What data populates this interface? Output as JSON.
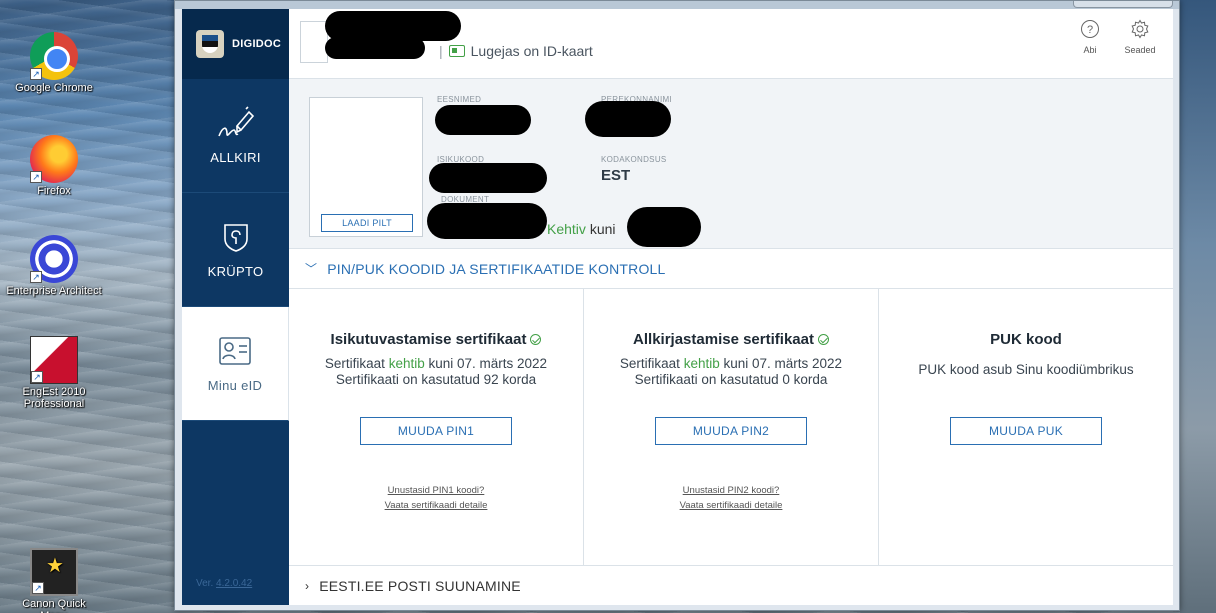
{
  "desktop": {
    "icons": [
      {
        "label": "Google Chrome",
        "icon": "chrome-icon"
      },
      {
        "label": "Firefox",
        "icon": "firefox-icon"
      },
      {
        "label": "Enterprise Architect",
        "icon": "enterprise-architect-icon"
      },
      {
        "label": "EngEst 2010 Professional",
        "icon": "engest-icon"
      },
      {
        "label": "Canon Quick Menu",
        "icon": "canon-quick-menu-icon"
      }
    ]
  },
  "app": {
    "brand": "DIGIDOC",
    "nav": [
      {
        "label": "ALLKIRI",
        "icon": "signature-icon"
      },
      {
        "label": "KRÜPTO",
        "icon": "shield-lock-icon"
      },
      {
        "label": "Minu eID",
        "icon": "id-card-icon",
        "active": true
      }
    ],
    "version_prefix": "Ver.",
    "version": "4.2.0.42"
  },
  "header": {
    "reader_status": "Lugejas on ID-kaart",
    "help_label": "Abi",
    "settings_label": "Seaded"
  },
  "person": {
    "given_names_label": "EESNIMED",
    "surname_label": "PEREKONNANIMI",
    "personal_code_label": "ISIKUKOOD",
    "citizenship_label": "KODAKONDSUS",
    "citizenship_value": "EST",
    "document_label": "DOKUMENT",
    "validity_status": "Kehtiv",
    "validity_until": "kuni",
    "load_photo_label": "LAADI PILT"
  },
  "sections": {
    "pin_puk_title": "PIN/PUK KOODID JA SERTIFIKAATIDE KONTROLL",
    "email_forward_title": "EESTI.EE POSTI SUUNAMINE"
  },
  "certs": {
    "auth": {
      "title": "Isikutuvastamise sertifikaat",
      "line1_prefix": "Sertifikaat",
      "line1_status": "kehtib",
      "line1_suffix": "kuni 07. märts 2022",
      "line2": "Sertifikaati on kasutatud 92 korda",
      "button": "MUUDA PIN1",
      "link_forgot": "Unustasid PIN1 koodi?",
      "link_details": "Vaata sertifikaadi detaile"
    },
    "sign": {
      "title": "Allkirjastamise sertifikaat",
      "line1_prefix": "Sertifikaat",
      "line1_status": "kehtib",
      "line1_suffix": "kuni 07. märts 2022",
      "line2": "Sertifikaati on kasutatud 0 korda",
      "button": "MUUDA PIN2",
      "link_forgot": "Unustasid PIN2 koodi?",
      "link_details": "Vaata sertifikaadi detaile"
    },
    "puk": {
      "title": "PUK kood",
      "description": "PUK kood asub Sinu koodiümbrikus",
      "button": "MUUDA PUK"
    }
  },
  "colors": {
    "sidebar": "#0d3763",
    "accent": "#2a6fb3",
    "ok": "#43a047"
  }
}
